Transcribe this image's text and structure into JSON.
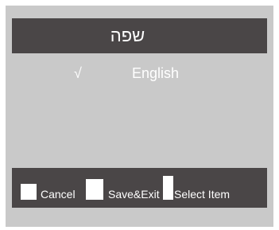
{
  "header": {
    "title": "שפה"
  },
  "language_list": {
    "items": [
      {
        "check": "√",
        "label": "English"
      }
    ]
  },
  "softkeys": {
    "cancel": "Cancel",
    "save_exit": "Save&Exit",
    "select_item": "Select Item"
  }
}
